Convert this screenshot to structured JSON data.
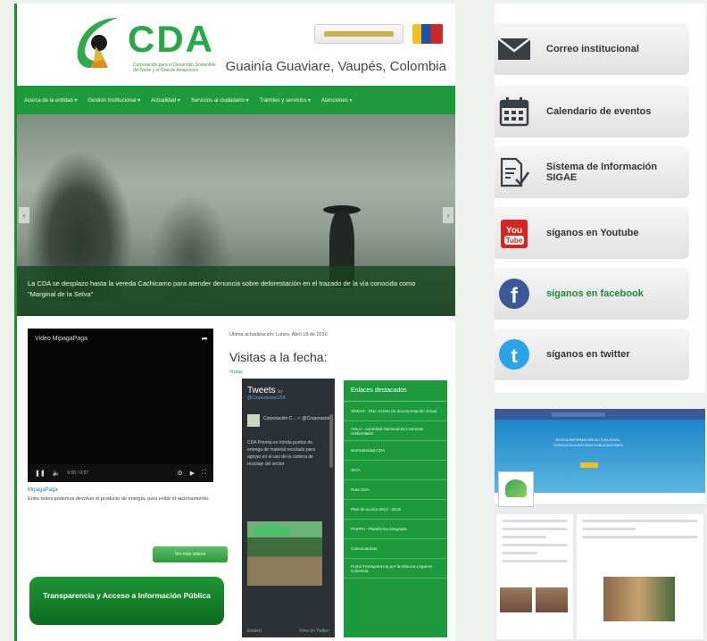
{
  "header": {
    "logo_text": "CDA",
    "logo_subtitle": "Corporación para el Desarrollo Sostenible del Norte y el Oriente Amazónico",
    "region": "Guainía Guaviare, Vaupés, Colombia"
  },
  "nav": {
    "items": [
      "Acerca de la entidad ▾",
      "Gestión Institucional ▾",
      "Actualidad ▾",
      "Servicios al ciudadano ▾",
      "Trámites y servicios ▾",
      "Atenciones ▾"
    ]
  },
  "hero": {
    "caption": "La CDA se desplazo hasta la vereda Cachicamo para atender denuncia sobre deforestación en el trazado de la vía conocida como \"Marginal de la Selva\""
  },
  "video": {
    "title": "Video MipagaPaga",
    "time": "0:00 / 0:57",
    "link": "MipagaPaga",
    "description": "Entre todos podemos devolver el producto de energía, para evitar el racionamiento.",
    "more_button": "Ver más videos"
  },
  "transparency": {
    "label": "Transparencia y Acceso a Información Pública"
  },
  "stats": {
    "updated": "Última actualización: Lunes, Abril 18 de 2016",
    "visits_title": "Visitas a la fecha:",
    "visits_label": "Visitas"
  },
  "twitter": {
    "title": "Tweets",
    "by": "by",
    "handle": "@CorporacionCDA",
    "author": "Corporación C... ✓ @Corporacion...",
    "text": "CDA Premia en Inírida puntos de entrega de material reciclado para apoyar en el uso de la cadena de reciclaje del sector",
    "footer_left": "Embed",
    "footer_right": "View on Twitter"
  },
  "enlaces": {
    "title": "Enlaces destacados",
    "links": [
      "SINCHI - SNA Centro de documentación virtual",
      "ANLA - Autoridad Nacional de Licencias Ambientales",
      "Normatividad CDA",
      "SICA",
      "Ruta CDA",
      "Plan de acción 2012 - 2015",
      "PAIPPA - Plataforma Integrada",
      "Convocatorias",
      "Portal Transparencia por la Infancia Legal en Colombia"
    ]
  },
  "sidebar": {
    "items": [
      {
        "label": "Correo institucional",
        "icon": "envelope-icon"
      },
      {
        "label": "Calendario de eventos",
        "icon": "calendar-icon"
      },
      {
        "label": "Sistema de Información SIGAE",
        "icon": "document-check-icon"
      },
      {
        "label": "síganos en Youtube",
        "icon": "youtube-icon"
      },
      {
        "label": "síganos en facebook",
        "icon": "facebook-icon"
      },
      {
        "label": "síganos en twitter",
        "icon": "twitter-icon"
      }
    ]
  },
  "facebook_preview": {
    "cover_text": "BUSCA INFORMACIÓN ACTUALIZADA, CONSULTA NUESTRAS PUBLICACIONES"
  },
  "colors": {
    "brand_green": "#1f9a3a",
    "facebook_blue": "#3b5998",
    "twitter_blue": "#2aa3e8",
    "youtube_red": "#d8261e"
  }
}
